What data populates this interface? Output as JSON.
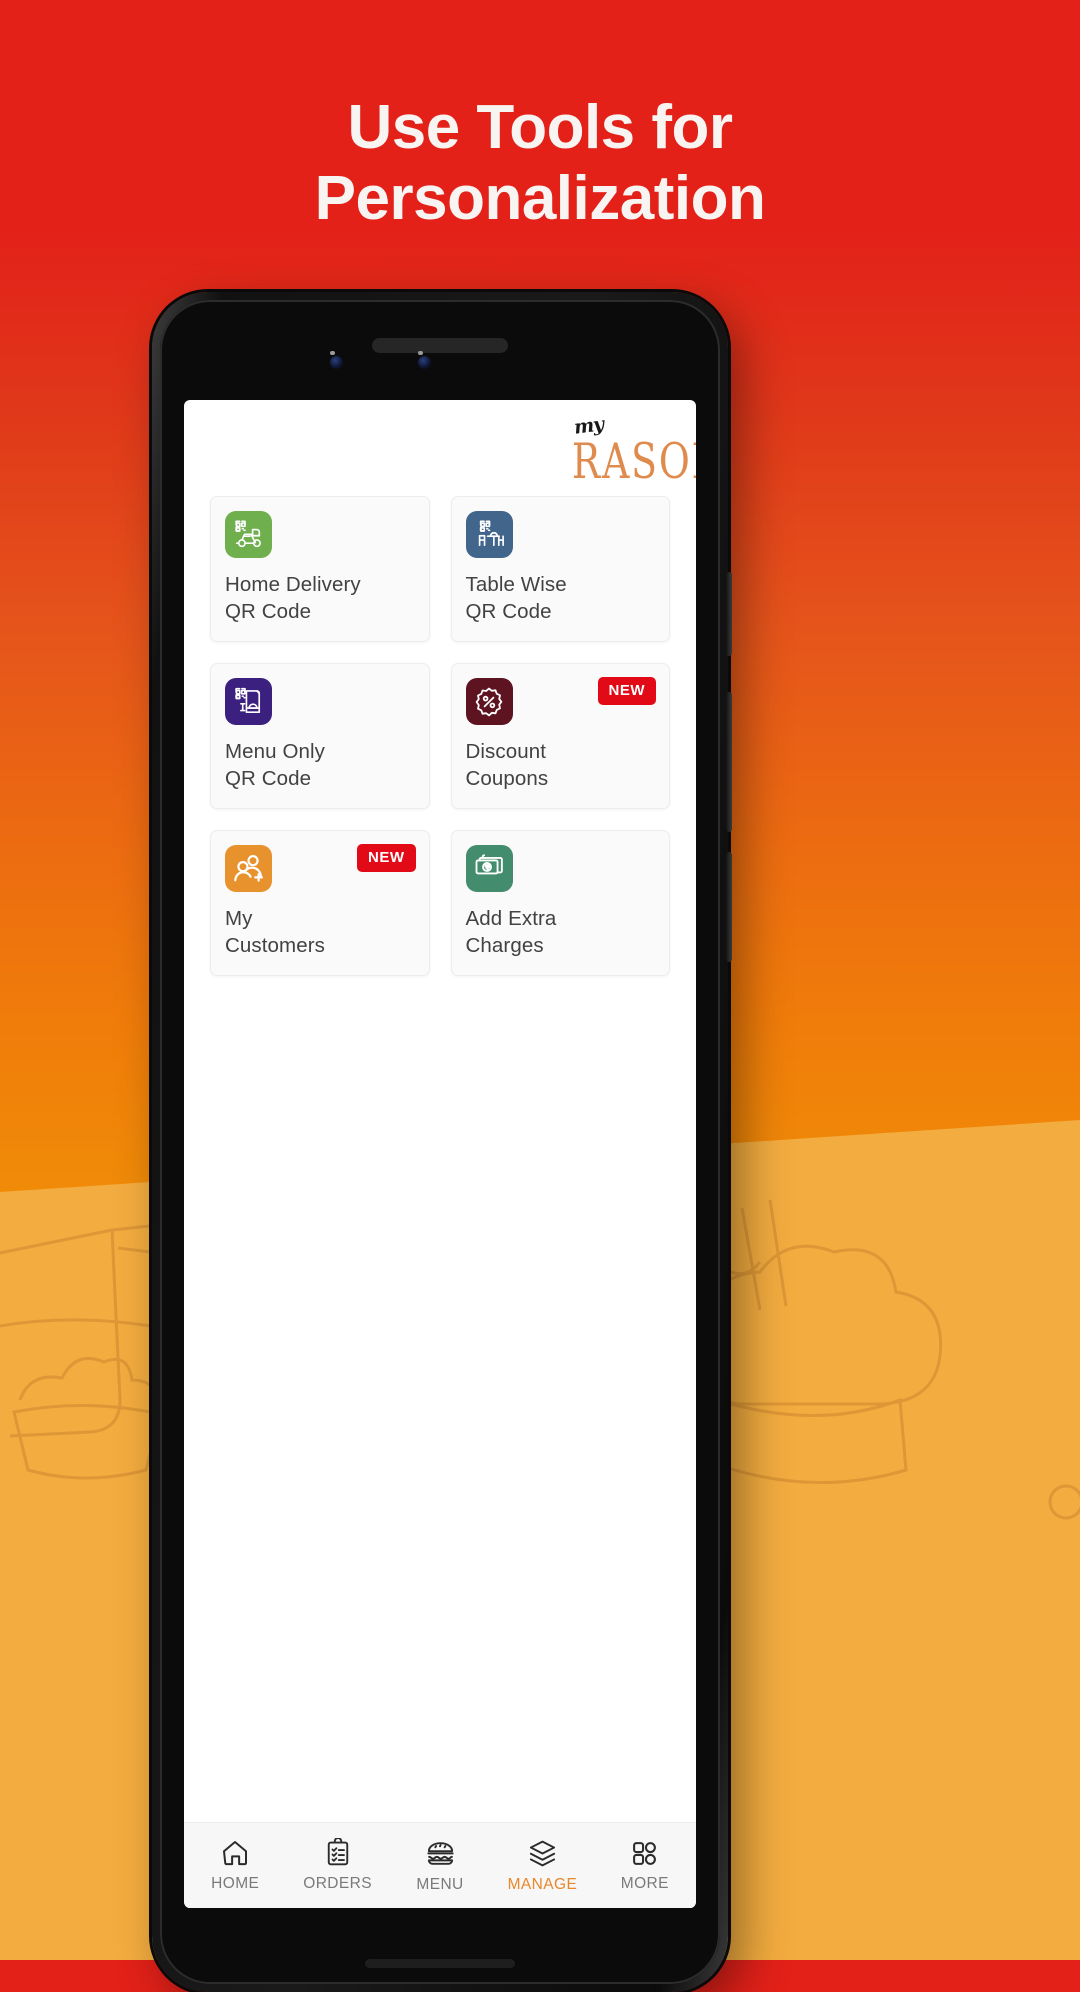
{
  "promo": {
    "headline_line1": "Use Tools for",
    "headline_line2": "Personalization",
    "bg_color_top": "#E32119",
    "bg_color_bottom": "#F3AE45",
    "headline_color": "#F7F4F2"
  },
  "app": {
    "logo": {
      "script_word": "my",
      "main_word": "RASOI",
      "script_color": "#181818",
      "main_color": "#E08B4E"
    },
    "tiles": [
      {
        "label": "Home Delivery\nQR Code",
        "icon": "qr-scooter-icon",
        "icon_color": "#6FAF4E",
        "badge": ""
      },
      {
        "label": "Table Wise\nQR Code",
        "icon": "qr-table-icon",
        "icon_color": "#42658C",
        "badge": ""
      },
      {
        "label": "Menu Only\nQR Code",
        "icon": "qr-menu-icon",
        "icon_color": "#3B2080",
        "badge": ""
      },
      {
        "label": "Discount\nCoupons",
        "icon": "discount-seal-icon",
        "icon_color": "#5E1320",
        "badge": "NEW"
      },
      {
        "label": "My\nCustomers",
        "icon": "add-people-icon",
        "icon_color": "#E8922E",
        "badge": "NEW"
      },
      {
        "label": "Add Extra\nCharges",
        "icon": "rupee-notes-icon",
        "icon_color": "#448C6E",
        "badge": ""
      }
    ],
    "badge_color": "#E30A17",
    "bottom_nav": {
      "active_color": "#E8872B",
      "inactive_color": "#7A7A7A",
      "items": [
        {
          "label": "HOME",
          "icon": "home-icon",
          "active": false
        },
        {
          "label": "ORDERS",
          "icon": "clipboard-icon",
          "active": false
        },
        {
          "label": "MENU",
          "icon": "burger-icon",
          "active": false
        },
        {
          "label": "MANAGE",
          "icon": "layers-icon",
          "active": true
        },
        {
          "label": "MORE",
          "icon": "grid-icon",
          "active": false
        }
      ]
    }
  }
}
